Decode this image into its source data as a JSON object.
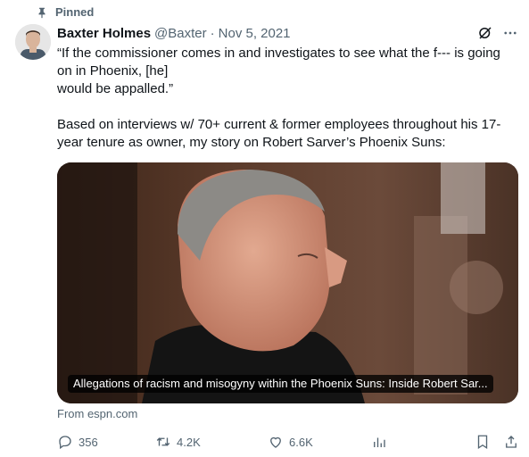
{
  "pinned_label": "Pinned",
  "author": {
    "name": "Baxter Holmes",
    "handle": "@Baxter",
    "date": "Nov 5, 2021"
  },
  "tweet": {
    "text": "“If the commissioner comes in and investigates to see what the f--- is going\non in Phoenix, [he]\nwould be appalled.”\n\nBased on interviews w/ 70+ current & former employees throughout his 17-\nyear tenure as owner, my story on Robert Sarver’s Phoenix Suns:"
  },
  "card": {
    "caption": "Allegations of racism and misogyny within the Phoenix Suns: Inside Robert Sar...",
    "source": "From espn.com"
  },
  "actions": {
    "replies": "356",
    "reposts": "4.2K",
    "likes": "6.6K"
  },
  "colors": {
    "secondary_text": "#536471",
    "primary_text": "#0f1419"
  }
}
